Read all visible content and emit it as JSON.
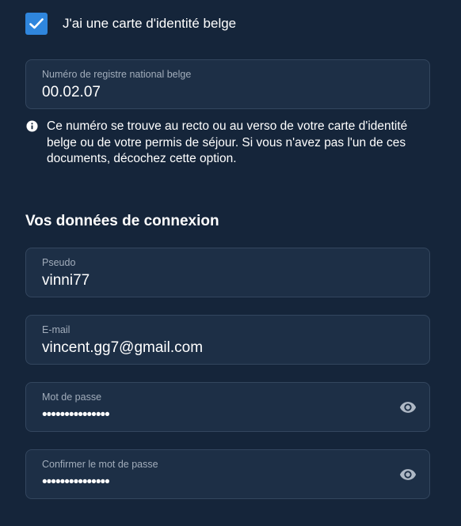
{
  "belgian_id": {
    "checkbox_label": "J'ai une carte d'identité belge",
    "checked": true
  },
  "national_register": {
    "label": "Numéro de registre national belge",
    "value": "00.02.07"
  },
  "info": {
    "text": "Ce numéro se trouve au recto ou au verso de votre carte d'identité belge ou de votre permis de séjour. Si vous n'avez pas l'un de ces documents, décochez cette option."
  },
  "login_section": {
    "title": "Vos données de connexion"
  },
  "fields": {
    "username": {
      "label": "Pseudo",
      "value": "vinni77"
    },
    "email": {
      "label": "E-mail",
      "value": "vincent.gg7@gmail.com"
    },
    "password": {
      "label": "Mot de passe",
      "masked_value": "•••••••••••••••"
    },
    "confirm_password": {
      "label": "Confirmer le mot de passe",
      "masked_value": "•••••••••••••••"
    }
  },
  "icons": {
    "checkbox": "checkmark-icon",
    "info": "info-icon",
    "toggle_visibility": "eye-icon"
  },
  "colors": {
    "background": "#15253a",
    "field_background": "#1d2f46",
    "field_border": "#33465e",
    "accent": "#2f86dd",
    "label_text": "#a2adbb"
  }
}
